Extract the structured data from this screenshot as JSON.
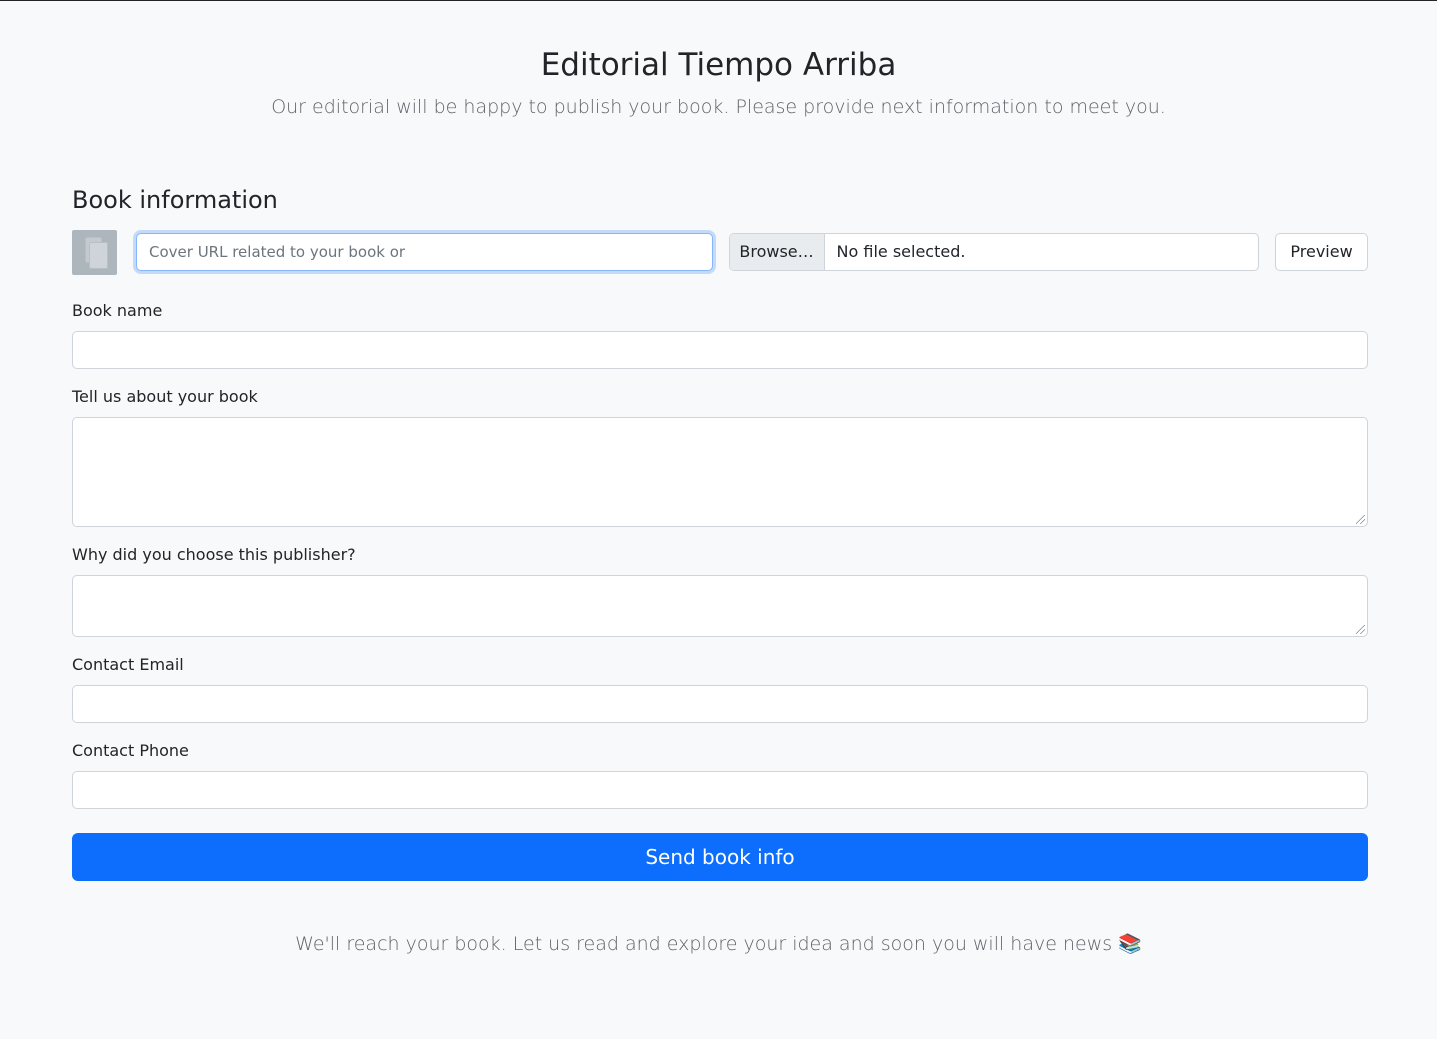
{
  "header": {
    "title": "Editorial Tiempo Arriba",
    "subtitle": "Our editorial will be happy to publish your book. Please provide next information to meet you."
  },
  "form": {
    "section_title": "Book information",
    "cover": {
      "thumbnail_icon": "image-placeholder-icon",
      "url_placeholder": "Cover URL related to your book or",
      "url_value": "",
      "browse_label": "Browse…",
      "file_status": "No file selected.",
      "preview_label": "Preview"
    },
    "book_name": {
      "label": "Book name",
      "value": ""
    },
    "about": {
      "label": "Tell us about your book",
      "value": ""
    },
    "why_publisher": {
      "label": "Why did you choose this publisher?",
      "value": ""
    },
    "email": {
      "label": "Contact Email",
      "value": ""
    },
    "phone": {
      "label": "Contact Phone",
      "value": ""
    },
    "submit_label": "Send book info"
  },
  "footer": {
    "message": "We'll reach your book. Let us read and explore your idea and soon you will have news 📚"
  },
  "colors": {
    "background": "#f8f9fa",
    "primary": "#0d6efd",
    "border": "#ced4da",
    "muted_text": "#5c636a"
  }
}
